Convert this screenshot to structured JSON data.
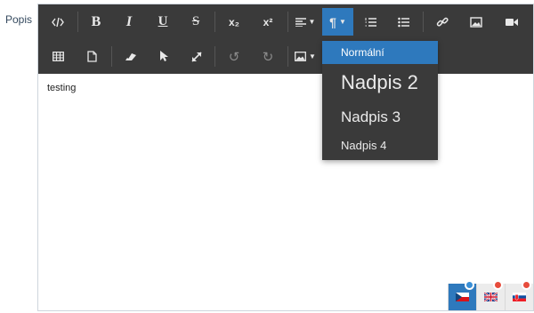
{
  "field": {
    "label": "Popis"
  },
  "editor": {
    "content": "testing"
  },
  "toolbar": {
    "subscript_label": "x₂",
    "superscript_label": "x²"
  },
  "heading_dropdown": {
    "selected": "Normální",
    "items": [
      {
        "label": "Normální"
      },
      {
        "label": "Nadpis 2"
      },
      {
        "label": "Nadpis 3"
      },
      {
        "label": "Nadpis 4"
      }
    ]
  },
  "languages": [
    {
      "code": "cz",
      "active": true
    },
    {
      "code": "en",
      "active": false
    },
    {
      "code": "sk",
      "active": false
    }
  ],
  "colors": {
    "toolbar_bg": "#3a3a3a",
    "accent": "#2e79bd",
    "badge_red": "#e74c3c"
  }
}
